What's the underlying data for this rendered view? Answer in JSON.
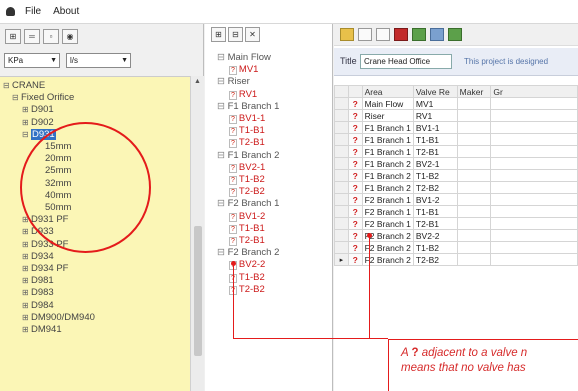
{
  "menu": {
    "file": "File",
    "about": "About"
  },
  "left": {
    "pressure_unit": "KPa",
    "flow_unit": "l/s",
    "tree": {
      "root": "CRANE",
      "group": "Fixed Orifice",
      "items_before": [
        "D901",
        "D902"
      ],
      "selected": "D931",
      "sizes": [
        "15mm",
        "20mm",
        "25mm",
        "32mm",
        "40mm",
        "50mm"
      ],
      "items_after": [
        "D931 PF",
        "D933",
        "D933 PF",
        "D934",
        "D934 PF",
        "D981",
        "D983",
        "D984",
        "DM900/DM940",
        "DM941"
      ]
    }
  },
  "middle": {
    "q": "?",
    "nodes": [
      {
        "kind": "group",
        "label": "Main Flow"
      },
      {
        "kind": "valve",
        "label": "MV1"
      },
      {
        "kind": "group",
        "label": "Riser"
      },
      {
        "kind": "valve",
        "label": "RV1"
      },
      {
        "kind": "group",
        "label": "F1 Branch 1"
      },
      {
        "kind": "valve",
        "label": "BV1-1"
      },
      {
        "kind": "valve",
        "label": "T1-B1"
      },
      {
        "kind": "valve",
        "label": "T2-B1"
      },
      {
        "kind": "group",
        "label": "F1 Branch 2"
      },
      {
        "kind": "valve",
        "label": "BV2-1"
      },
      {
        "kind": "valve",
        "label": "T1-B2"
      },
      {
        "kind": "valve",
        "label": "T2-B2"
      },
      {
        "kind": "group",
        "label": "F2 Branch 1"
      },
      {
        "kind": "valve",
        "label": "BV1-2"
      },
      {
        "kind": "valve",
        "label": "T1-B1"
      },
      {
        "kind": "valve",
        "label": "T2-B1"
      },
      {
        "kind": "group",
        "label": "F2 Branch 2"
      },
      {
        "kind": "valve",
        "label": "BV2-2"
      },
      {
        "kind": "valve",
        "label": "T1-B2"
      },
      {
        "kind": "valve",
        "label": "T2-B2"
      }
    ]
  },
  "right": {
    "title_label": "Title",
    "title_value": "Crane Head Office",
    "description": "This project is designed",
    "columns": [
      "Area",
      "Valve Re",
      "Maker",
      "Gr"
    ],
    "rows": [
      {
        "q": "?",
        "area": "Main Flow",
        "valve": "MV1"
      },
      {
        "q": "?",
        "area": "Riser",
        "valve": "RV1"
      },
      {
        "q": "?",
        "area": "F1 Branch 1",
        "valve": "BV1-1"
      },
      {
        "q": "?",
        "area": "F1 Branch 1",
        "valve": "T1-B1"
      },
      {
        "q": "?",
        "area": "F1 Branch 1",
        "valve": "T2-B1"
      },
      {
        "q": "?",
        "area": "F1 Branch 2",
        "valve": "BV2-1"
      },
      {
        "q": "?",
        "area": "F1 Branch 2",
        "valve": "T1-B2"
      },
      {
        "q": "?",
        "area": "F1 Branch 2",
        "valve": "T2-B2"
      },
      {
        "q": "?",
        "area": "F2 Branch 1",
        "valve": "BV1-2"
      },
      {
        "q": "?",
        "area": "F2 Branch 1",
        "valve": "T1-B1"
      },
      {
        "q": "?",
        "area": "F2 Branch 1",
        "valve": "T2-B1"
      },
      {
        "q": "?",
        "area": "F2 Branch 2",
        "valve": "BV2-2"
      },
      {
        "q": "?",
        "area": "F2 Branch 2",
        "valve": "T1-B2"
      },
      {
        "q": "?",
        "area": "F2 Branch 2",
        "valve": "T2-B2"
      }
    ]
  },
  "annotation": {
    "prefix": "A",
    "q": "?",
    "line1_rest": "adjacent to a valve n",
    "line2": "means that no valve has"
  },
  "colors": {
    "accent_red": "#e41b1b",
    "tree_yellow": "#fbf6b6",
    "selection_blue": "#3272c4"
  }
}
